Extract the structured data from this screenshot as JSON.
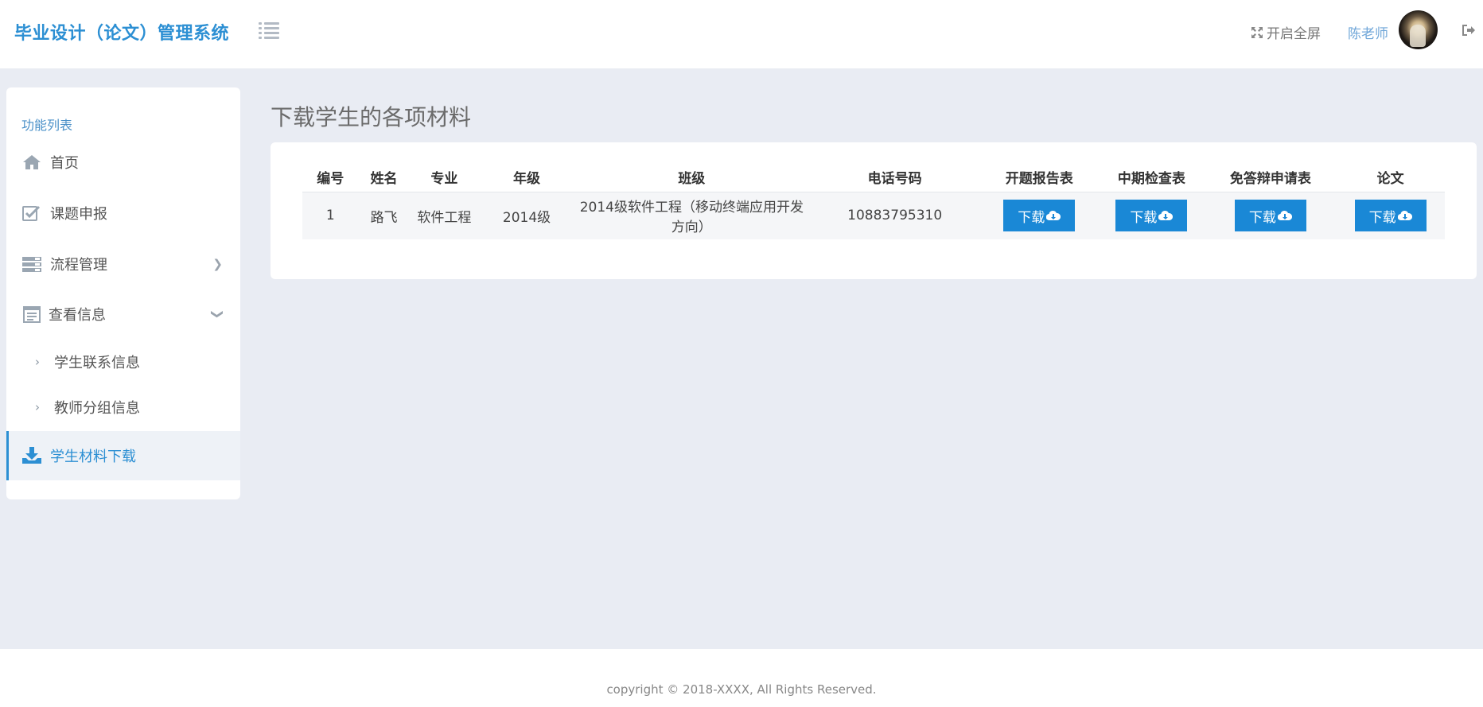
{
  "header": {
    "brand": "毕业设计（论文）管理系统",
    "fullscreen_label": "开启全屏",
    "user_name": "陈老师"
  },
  "sidebar": {
    "title": "功能列表",
    "items": [
      {
        "label": "首页",
        "icon": "home-icon"
      },
      {
        "label": "课题申报",
        "icon": "checkbox-icon"
      },
      {
        "label": "流程管理",
        "icon": "server-icon",
        "chevron": "right"
      },
      {
        "label": "查看信息",
        "icon": "calendar-icon",
        "chevron": "down"
      },
      {
        "label": "学生联系信息",
        "sub": true
      },
      {
        "label": "教师分组信息",
        "sub": true
      },
      {
        "label": "学生材料下载",
        "icon": "download-icon",
        "active": true
      }
    ]
  },
  "main": {
    "page_title": "下载学生的各项材料",
    "table": {
      "headers": [
        "编号",
        "姓名",
        "专业",
        "年级",
        "班级",
        "电话号码",
        "开题报告表",
        "中期检查表",
        "免答辩申请表",
        "论文"
      ],
      "rows": [
        {
          "id": "1",
          "name": "路飞",
          "major": "软件工程",
          "grade": "2014级",
          "class": "2014级软件工程（移动终端应用开发方向）",
          "phone": "10883795310",
          "buttons": [
            "下载",
            "下载",
            "下载",
            "下载"
          ]
        }
      ]
    }
  },
  "footer": {
    "copyright": "copyright © 2018-XXXX, All Rights Reserved."
  },
  "colors": {
    "accent": "#2c8fd3",
    "button": "#1a88d6",
    "background": "#e9ecf3"
  }
}
